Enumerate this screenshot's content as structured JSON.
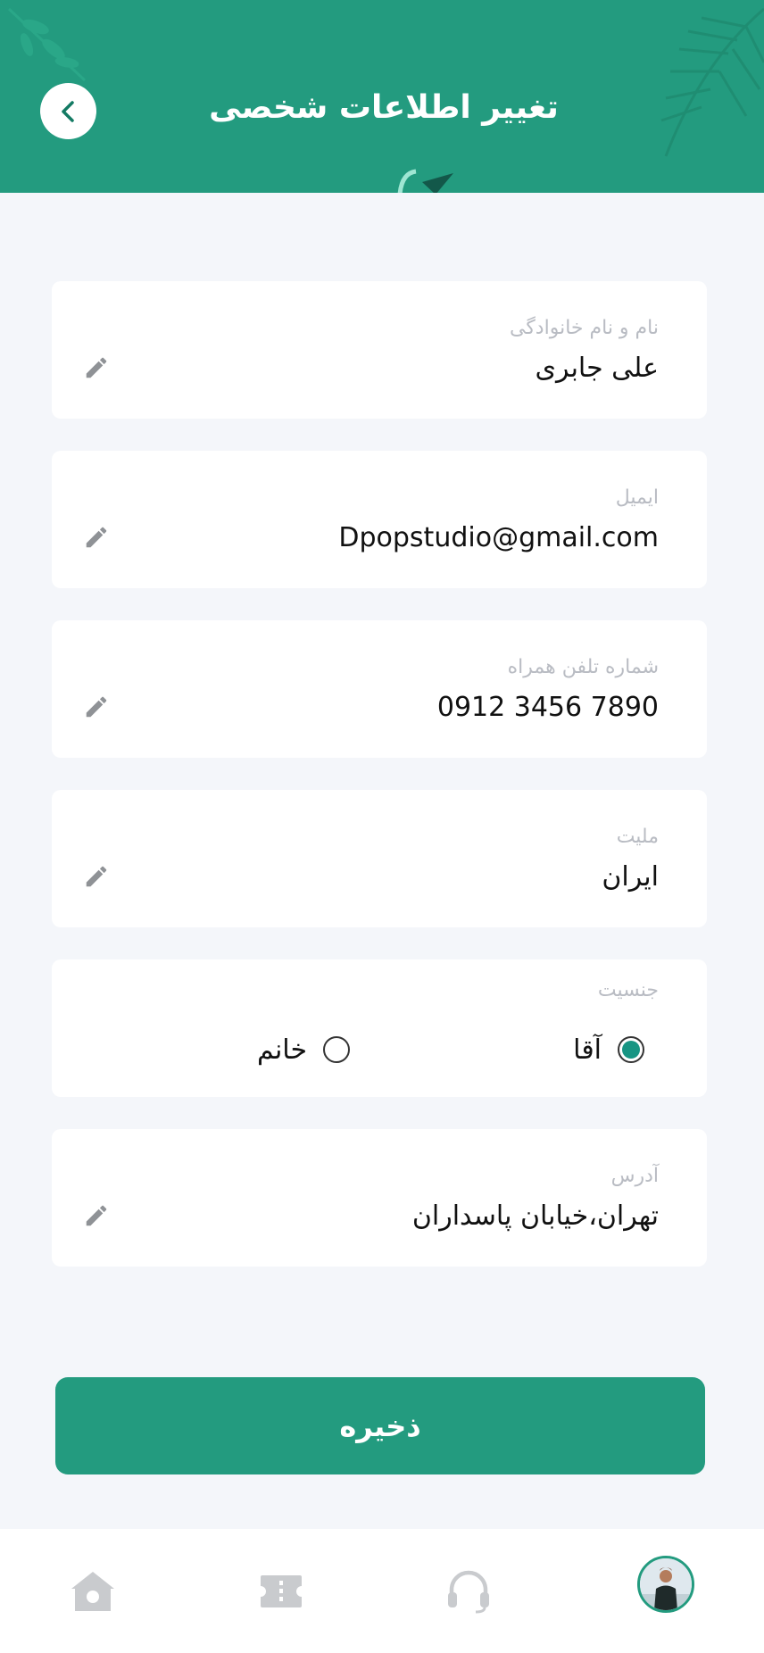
{
  "header": {
    "title": "تغییر اطلاعات شخصی",
    "back_icon": "chevron-left-icon"
  },
  "fields": {
    "name": {
      "label": "نام و نام خانوادگی",
      "value": "علی جابری"
    },
    "email": {
      "label": "ایمیل",
      "value": "Dpopstudio@gmail.com"
    },
    "phone": {
      "label": "شماره تلفن همراه",
      "value": "0912 3456 7890"
    },
    "nationality": {
      "label": "ملیت",
      "value": "ایران"
    },
    "address": {
      "label": "آدرس",
      "value": "تهران،خیابان پاسداران"
    }
  },
  "gender": {
    "label": "جنسیت",
    "options": [
      {
        "label": "آقا",
        "selected": true
      },
      {
        "label": "خانم",
        "selected": false
      }
    ]
  },
  "save_button": {
    "label": "ذخیره"
  },
  "bottom_nav": {
    "items": [
      "home-icon",
      "ticket-icon",
      "headset-icon",
      "avatar"
    ]
  },
  "colors": {
    "primary": "#239b7f",
    "radio_fill": "#179583",
    "background": "#f4f6fa",
    "label_gray": "#b9bcc3"
  }
}
